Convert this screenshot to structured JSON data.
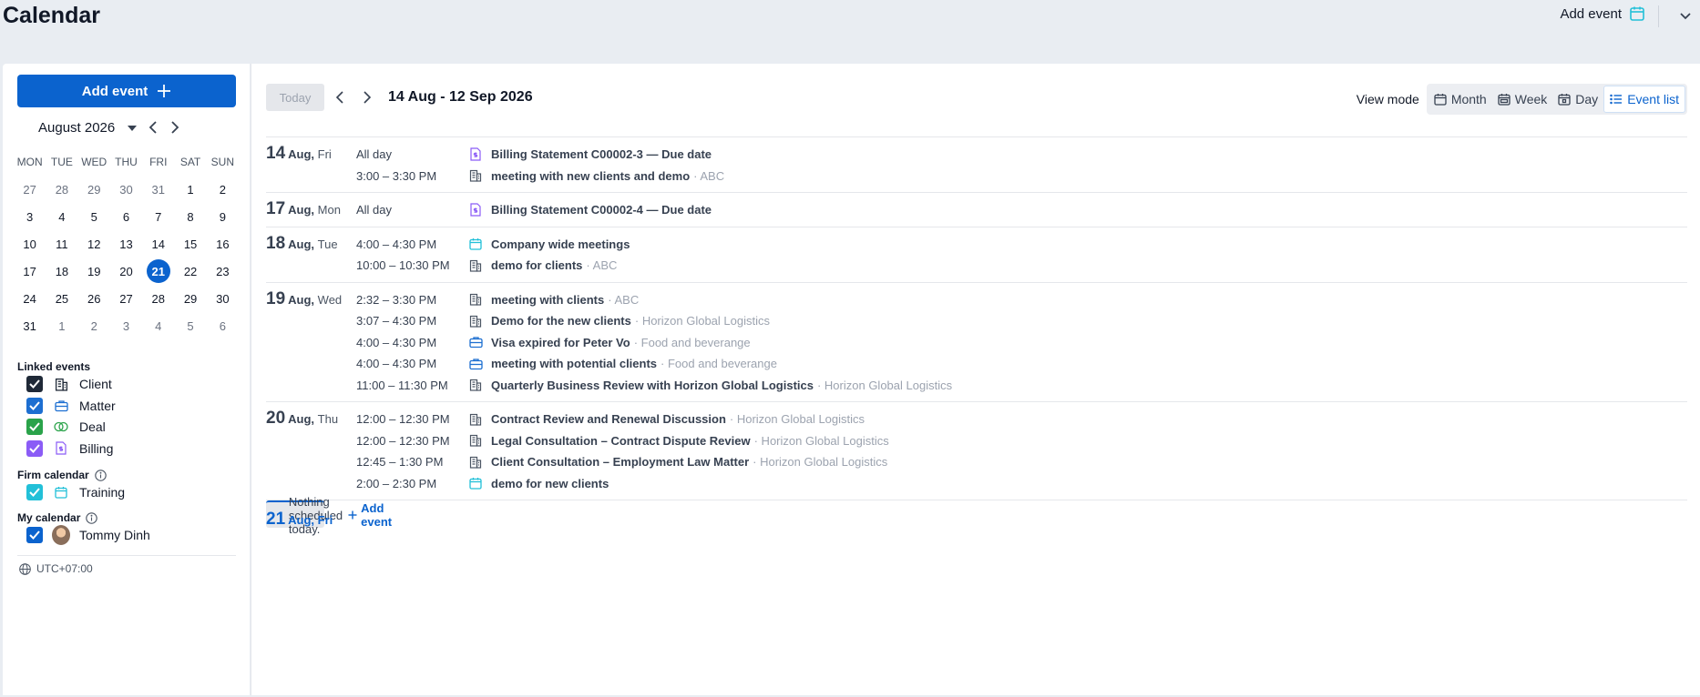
{
  "header": {
    "title": "Calendar",
    "add_event_label": "Add event"
  },
  "colors": {
    "accent": "#0b63ce",
    "client": "#1f2937",
    "matter": "#1d6fd1",
    "deal": "#2aa34a",
    "billing": "#8b5cf6",
    "training": "#22c0d8"
  },
  "sidebar": {
    "add_event_label": "Add event",
    "mini_calendar": {
      "month_label": "August 2026",
      "weekdays": [
        "MON",
        "TUE",
        "WED",
        "THU",
        "FRI",
        "SAT",
        "SUN"
      ],
      "weeks": [
        [
          "27",
          "28",
          "29",
          "30",
          "31",
          "1",
          "2"
        ],
        [
          "3",
          "4",
          "5",
          "6",
          "7",
          "8",
          "9"
        ],
        [
          "10",
          "11",
          "12",
          "13",
          "14",
          "15",
          "16"
        ],
        [
          "17",
          "18",
          "19",
          "20",
          "21",
          "22",
          "23"
        ],
        [
          "24",
          "25",
          "26",
          "27",
          "28",
          "29",
          "30"
        ],
        [
          "31",
          "1",
          "2",
          "3",
          "4",
          "5",
          "6"
        ]
      ],
      "selected": "21"
    },
    "linked_events_title": "Linked events",
    "linked_events": [
      {
        "label": "Client",
        "icon": "building-icon"
      },
      {
        "label": "Matter",
        "icon": "briefcase-icon"
      },
      {
        "label": "Deal",
        "icon": "deal-icon"
      },
      {
        "label": "Billing",
        "icon": "invoice-icon"
      }
    ],
    "firm_calendar_title": "Firm calendar",
    "firm_calendar": [
      {
        "label": "Training",
        "icon": "calendar-icon"
      }
    ],
    "my_calendar_title": "My calendar",
    "my_calendar": [
      {
        "label": "Tommy Dinh",
        "icon": "avatar"
      }
    ],
    "timezone": "UTC+07:00"
  },
  "toolbar": {
    "today_label": "Today",
    "range_label": "14 Aug - 12 Sep 2026",
    "view_mode_label": "View mode",
    "views": [
      "Month",
      "Week",
      "Day",
      "Event list"
    ],
    "active_view": "Event list"
  },
  "event_list": [
    {
      "num": "14",
      "md": "Aug,",
      "wd": "Fri",
      "events": [
        {
          "time": "All day",
          "icon": "invoice-icon",
          "title": "Billing Statement C00002-3 — Due date",
          "sub": ""
        },
        {
          "time": "3:00 – 3:30 PM",
          "icon": "building-icon",
          "title": "meeting with new clients and demo",
          "sub": "· ABC"
        }
      ]
    },
    {
      "num": "17",
      "md": "Aug,",
      "wd": "Mon",
      "events": [
        {
          "time": "All day",
          "icon": "invoice-icon",
          "title": "Billing Statement C00002-4 — Due date",
          "sub": ""
        }
      ]
    },
    {
      "num": "18",
      "md": "Aug,",
      "wd": "Tue",
      "events": [
        {
          "time": "4:00 – 4:30 PM",
          "icon": "calendar-icon",
          "title": "Company wide meetings",
          "sub": ""
        },
        {
          "time": "10:00 – 10:30 PM",
          "icon": "building-icon",
          "title": "demo for clients",
          "sub": "· ABC"
        }
      ]
    },
    {
      "num": "19",
      "md": "Aug,",
      "wd": "Wed",
      "events": [
        {
          "time": "2:32 – 3:30 PM",
          "icon": "building-icon",
          "title": "meeting with clients",
          "sub": "· ABC"
        },
        {
          "time": "3:07 – 4:30 PM",
          "icon": "building-icon",
          "title": "Demo for the new clients",
          "sub": "· Horizon Global Logistics"
        },
        {
          "time": "4:00 – 4:30 PM",
          "icon": "briefcase-icon",
          "title": "Visa expired for Peter Vo",
          "sub": "· Food and beverange"
        },
        {
          "time": "4:00 – 4:30 PM",
          "icon": "briefcase-icon",
          "title": "meeting with potential clients",
          "sub": "· Food and beverange"
        },
        {
          "time": "11:00 – 11:30 PM",
          "icon": "building-icon",
          "title": "Quarterly Business Review with Horizon Global Logistics",
          "sub": "· Horizon Global Logistics"
        }
      ]
    },
    {
      "num": "20",
      "md": "Aug,",
      "wd": "Thu",
      "events": [
        {
          "time": "12:00 – 12:30 PM",
          "icon": "building-icon",
          "title": "Contract Review and Renewal Discussion",
          "sub": "· Horizon Global Logistics"
        },
        {
          "time": "12:00 – 12:30 PM",
          "icon": "building-icon",
          "title": "Legal Consultation – Contract Dispute Review",
          "sub": "· Horizon Global Logistics"
        },
        {
          "time": "12:45 – 1:30 PM",
          "icon": "building-icon",
          "title": "Client Consultation – Employment Law Matter",
          "sub": "· Horizon Global Logistics"
        },
        {
          "time": "2:00 – 2:30 PM",
          "icon": "calendar-icon",
          "title": "demo for new clients",
          "sub": ""
        }
      ]
    }
  ],
  "today_row": {
    "num": "21",
    "md": "Aug,",
    "wd": "Fri",
    "nothing_label": "Nothing scheduled today.",
    "add_label": "Add event"
  }
}
